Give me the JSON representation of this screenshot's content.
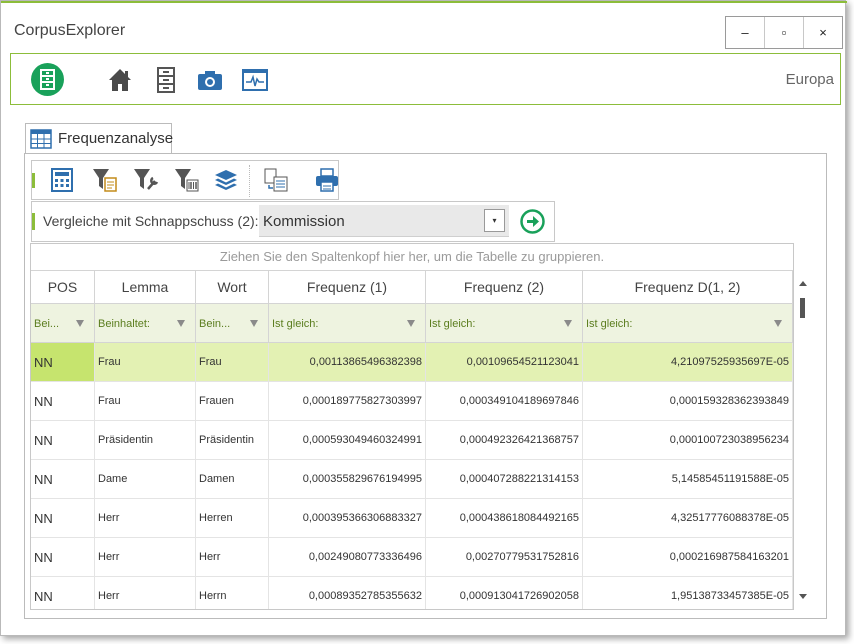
{
  "app": {
    "title": "CorpusExplorer",
    "corpus": "Europa"
  },
  "window_controls": {
    "minimize": "–",
    "maximize": "▫",
    "close": "×"
  },
  "ribbon": {
    "icons": [
      "app-logo-icon",
      "home-icon",
      "cabinet-icon",
      "camera-icon",
      "monitor-icon"
    ]
  },
  "tab": {
    "label": "Frequenzanalyse",
    "icon": "table-icon"
  },
  "toolbar": {
    "icons": [
      "calculator-icon",
      "filter-clipboard-icon",
      "filter-tools-icon",
      "filter-barcode-icon",
      "layers-icon",
      "export-copy-icon",
      "print-icon"
    ]
  },
  "compare": {
    "label": "Vergleiche mit Schnappschuss (2):",
    "value": "Kommission",
    "dropdown_glyph": "▾"
  },
  "grid": {
    "group_hint": "Ziehen Sie den Spaltenkopf hier her, um die Tabelle zu gruppieren.",
    "columns": [
      "POS",
      "Lemma",
      "Wort",
      "Frequenz (1)",
      "Frequenz (2)",
      "Frequenz D(1, 2)"
    ],
    "filters": [
      "Bei...",
      "Beinhaltet:",
      "Bein...",
      "Ist gleich:",
      "Ist gleich:",
      "Ist gleich:"
    ],
    "rows": [
      {
        "pos": "NN",
        "lemma": "Frau",
        "wort": "Frau",
        "f1": "0,00113865496382398",
        "f2": "0,00109654521123041",
        "fd": "4,21097525935697E-05",
        "selected": true
      },
      {
        "pos": "NN",
        "lemma": "Frau",
        "wort": "Frauen",
        "f1": "0,000189775827303997",
        "f2": "0,000349104189697846",
        "fd": "0,000159328362393849"
      },
      {
        "pos": "NN",
        "lemma": "Präsidentin",
        "wort": "Präsidentin",
        "f1": "0,000593049460324991",
        "f2": "0,000492326421368757",
        "fd": "0,000100723038956234"
      },
      {
        "pos": "NN",
        "lemma": "Dame",
        "wort": "Damen",
        "f1": "0,000355829676194995",
        "f2": "0,000407288221314153",
        "fd": "5,14585451191588E-05"
      },
      {
        "pos": "NN",
        "lemma": "Herr",
        "wort": "Herren",
        "f1": "0,000395366306883327",
        "f2": "0,000438618084492165",
        "fd": "4,32517776088378E-05"
      },
      {
        "pos": "NN",
        "lemma": "Herr",
        "wort": "Herr",
        "f1": "0,00249080773336496",
        "f2": "0,00270779531752816",
        "fd": "0,000216987584163201"
      },
      {
        "pos": "NN",
        "lemma": "Herr",
        "wort": "Herrn",
        "f1": "0,00089352785355632",
        "f2": "0,000913041726902058",
        "fd": "1,95138733457385E-05"
      }
    ]
  },
  "colors": {
    "accent": "#8cbd3a",
    "selected_row": "#e3f1b3",
    "selected_cell": "#c6e46e",
    "filter_text": "#5b7d1e",
    "icon_blue": "#2f6fae"
  }
}
